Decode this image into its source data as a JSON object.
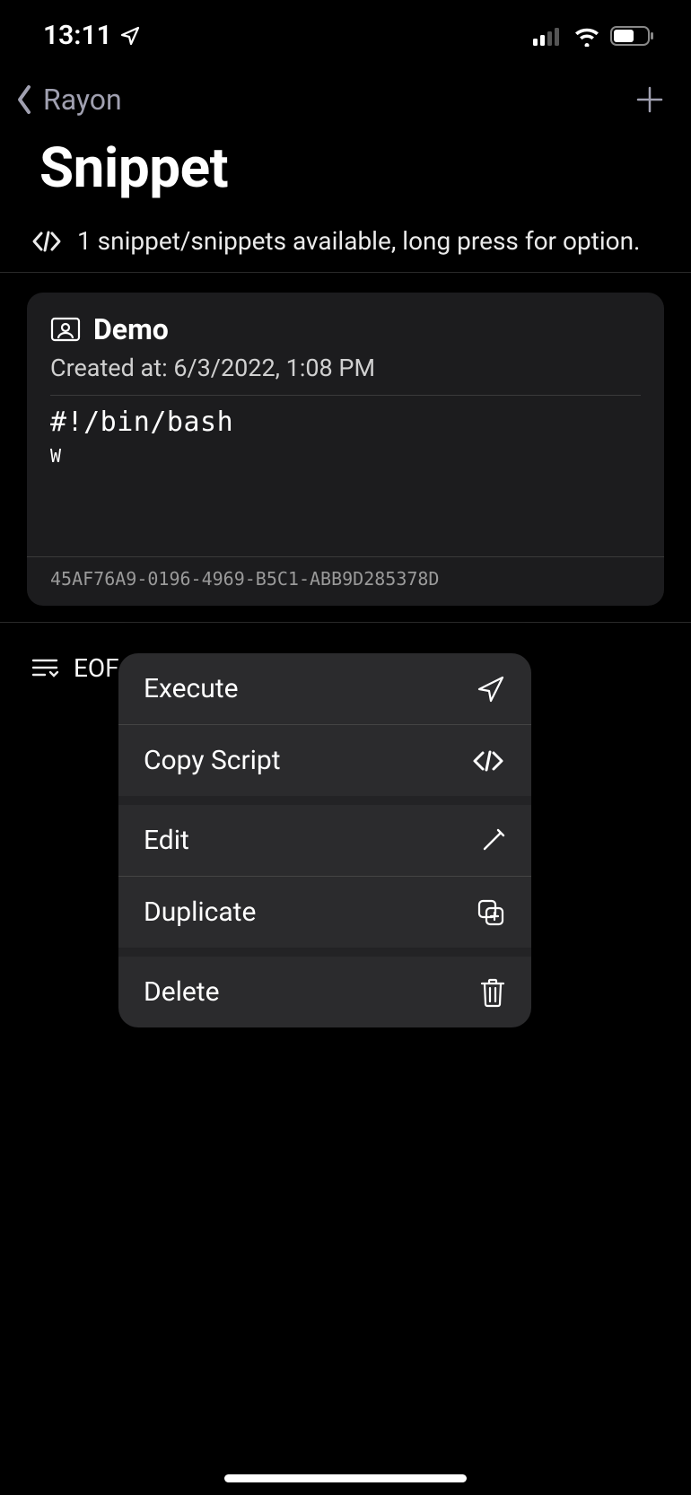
{
  "status": {
    "time": "13:11"
  },
  "nav": {
    "back_label": "Rayon"
  },
  "page": {
    "title": "Snippet",
    "subtitle": "1 snippet/snippets available, long press for option."
  },
  "card": {
    "title": "Demo",
    "created_prefix": "Created at: ",
    "created_value": "6/3/2022, 1:08 PM",
    "code_line1": "#!/bin/bash",
    "code_line2": "W",
    "id": "45AF76A9-0196-4969-B5C1-ABB9D285378D"
  },
  "eof": {
    "label": "EOF"
  },
  "menu": {
    "items": [
      {
        "label": "Execute"
      },
      {
        "label": "Copy Script"
      },
      {
        "label": "Edit"
      },
      {
        "label": "Duplicate"
      },
      {
        "label": "Delete"
      }
    ]
  }
}
